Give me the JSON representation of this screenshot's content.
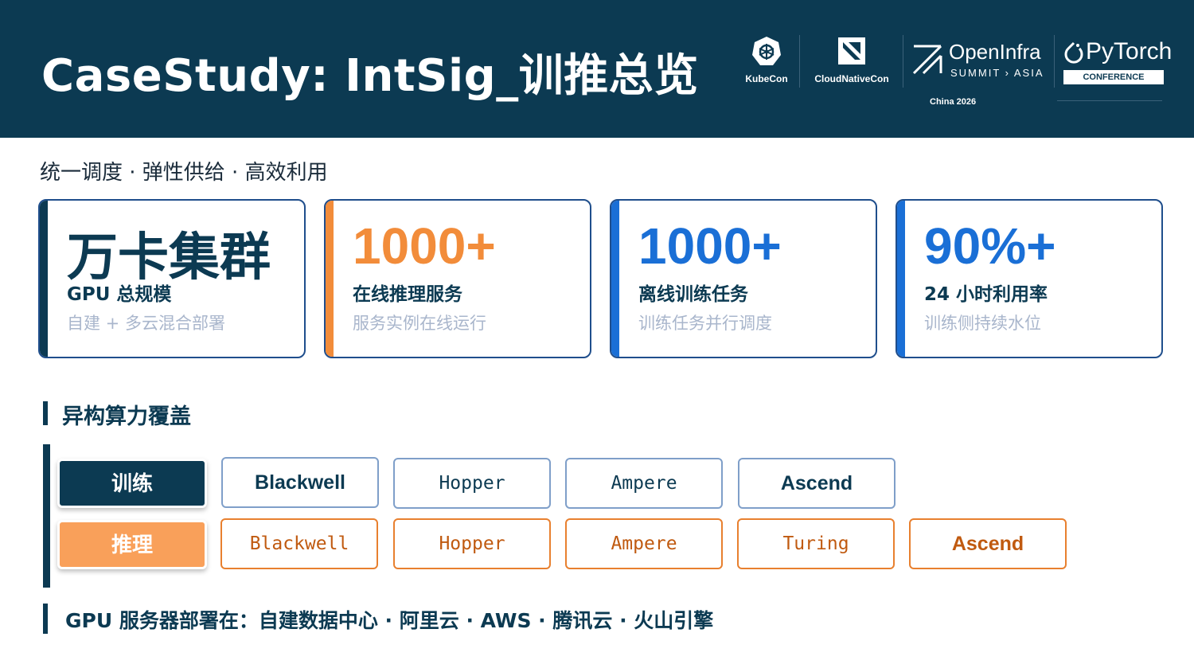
{
  "header": {
    "title": "CaseStudy: IntSig_训推总览",
    "logos": {
      "kubecon": "KubeCon",
      "cloudnativecon": "CloudNativeCon",
      "openinfra_name": "OpenInfra",
      "openinfra_sub": "SUMMIT › ASIA",
      "pytorch_name": "PyTorch",
      "pytorch_badge": "CONFERENCE",
      "event_location": "China 2026"
    }
  },
  "subtitle": "统一调度 · 弹性供给 · 高效利用",
  "stats": [
    {
      "value": "万卡集群",
      "label": "GPU 总规模",
      "desc": "自建 + 多云混合部署",
      "color": "#0c3a52"
    },
    {
      "value": "1000+",
      "label": "在线推理服务",
      "desc": "服务实例在线运行",
      "color": "#f28c3a"
    },
    {
      "value": "1000+",
      "label": "离线训练任务",
      "desc": "训练任务并行调度",
      "color": "#1a6fd6"
    },
    {
      "value": "90%+",
      "label": "24 小时利用率",
      "desc": "训练侧持续水位",
      "color": "#1a6fd6"
    }
  ],
  "section_title": "异构算力覆盖",
  "training": {
    "role": "训练",
    "role_color": "#0c3a52",
    "chips": [
      "Blackwell",
      "Hopper",
      "Ampere",
      "Ascend"
    ]
  },
  "inference": {
    "role": "推理",
    "role_color": "#f9a05a",
    "chips": [
      "Blackwell",
      "Hopper",
      "Ampere",
      "Turing",
      "Ascend"
    ]
  },
  "footer": "GPU 服务器部署在：自建数据中心 · 阿里云 · AWS · 腾讯云 · 火山引擎"
}
